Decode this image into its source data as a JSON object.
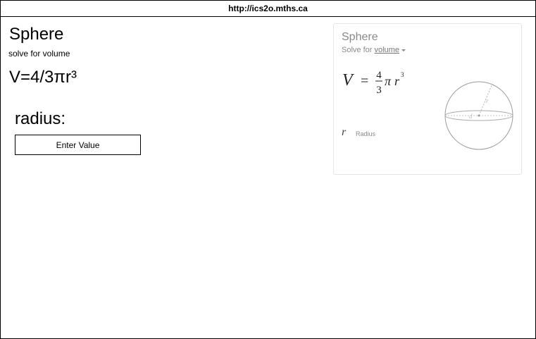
{
  "browser": {
    "url": "http://ics2o.mths.ca"
  },
  "calculator": {
    "title": "Sphere",
    "subtitle": "solve for volume",
    "formula": "V=4/3πr³",
    "radius_label": "radius:",
    "radius_placeholder": "Enter Value"
  },
  "reference_card": {
    "title": "Sphere",
    "solve_for_prefix": "Solve for",
    "solve_for_value": "volume",
    "formula": {
      "lhs": "V",
      "equals": "=",
      "numerator": "4",
      "denominator": "3",
      "pi": "π",
      "var": "r",
      "exponent": "3"
    },
    "variable": {
      "symbol": "r",
      "description": "Radius"
    },
    "diagram": {
      "radius_label": "r",
      "diameter_label": "d"
    }
  }
}
